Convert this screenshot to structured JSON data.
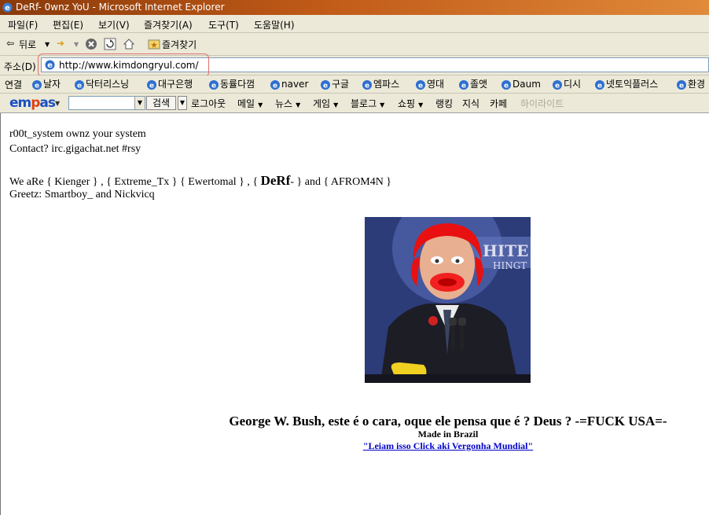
{
  "window": {
    "title": "DeRf- 0wnz YoU - Microsoft Internet Explorer"
  },
  "menu": [
    "파일(F)",
    "편집(E)",
    "보기(V)",
    "즐겨찾기(A)",
    "도구(T)",
    "도움말(H)"
  ],
  "toolbar": {
    "back_label": "뒤로",
    "favorites_label": "즐겨찾기"
  },
  "address": {
    "label": "주소(D)",
    "url": "http://www.kimdongryul.com/"
  },
  "links": {
    "label": "연결",
    "items": [
      "날자",
      "닥터리스닝",
      "대구은행",
      "동률다껌",
      "naver",
      "구글",
      "엠파스",
      "영대",
      "졸앳",
      "Daum",
      "디시",
      "넷토익플러스",
      "환경"
    ]
  },
  "empas": {
    "logo": "empas",
    "search_button": "검색",
    "menus": [
      "로그아웃",
      "메일",
      "뉴스",
      "게임",
      "블로그",
      "쇼핑",
      "랭킹",
      "지식",
      "카페"
    ],
    "highlight_label": "하이라이트"
  },
  "page": {
    "line1": "r00t_system ownz your system",
    "line2": "Contact? irc.gigachat.net #rsy",
    "crew_pre": "We aRe { Kienger } , { Extreme_Tx } { Ewertomal } , { ",
    "crew_bold": "DeRf",
    "crew_post": "- } and { AFROM4N }",
    "greetz": "Greetz: Smartboy_ and Nickvicq",
    "caption": "George W. Bush, este é o cara, oque ele pensa que é ? Deus ? -=FUCK USA=-",
    "made_in": "Made in Brazil",
    "link_text": "\"Leiam isso Click aki Vergonha Mundial\""
  }
}
